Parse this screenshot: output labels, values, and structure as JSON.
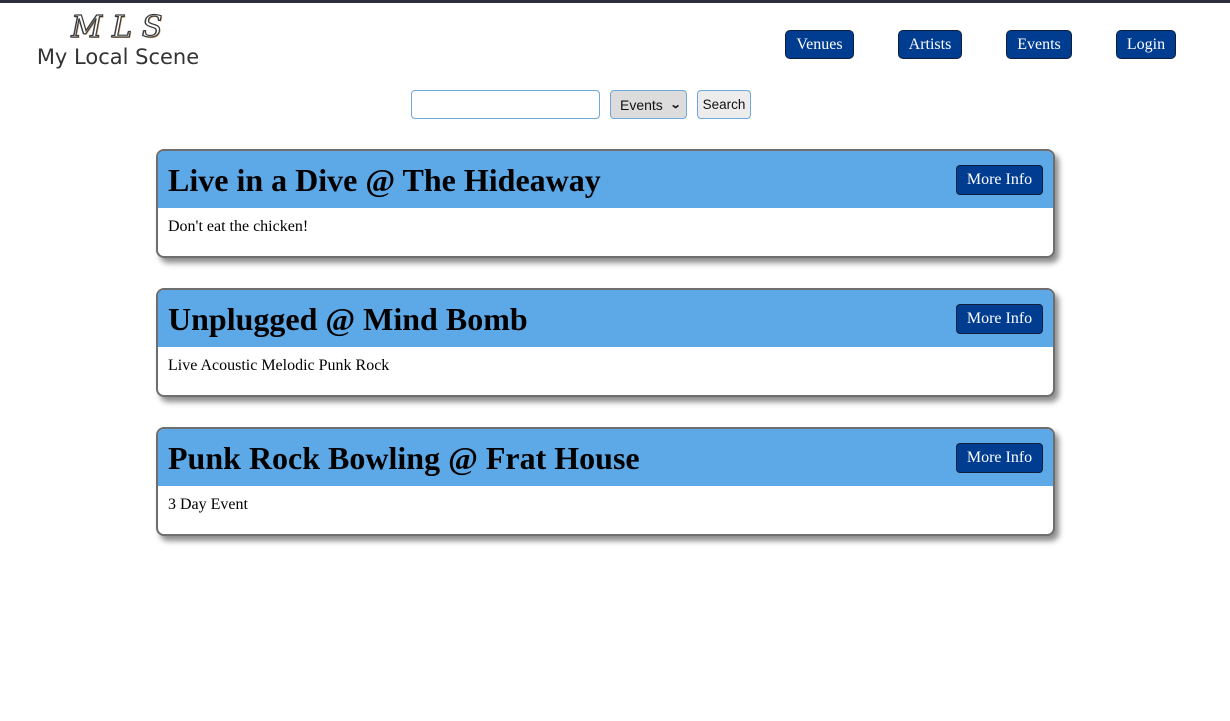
{
  "header": {
    "logo_mark": "MLS",
    "logo_text": "My Local Scene"
  },
  "nav": {
    "items": [
      {
        "label": "Venues"
      },
      {
        "label": "Artists"
      },
      {
        "label": "Events"
      },
      {
        "label": "Login"
      }
    ]
  },
  "search": {
    "value": "",
    "placeholder": "",
    "category_selected": "Events",
    "button_label": "Search"
  },
  "events": [
    {
      "title": "Live in a Dive @ The Hideaway",
      "description": "Don't eat the chicken!",
      "button_label": "More Info"
    },
    {
      "title": "Unplugged @ Mind Bomb",
      "description": "Live Acoustic Melodic Punk Rock",
      "button_label": "More Info"
    },
    {
      "title": "Punk Rock Bowling @ Frat House",
      "description": "3 Day Event",
      "button_label": "More Info"
    }
  ],
  "colors": {
    "nav_button": "#003d91",
    "card_header": "#5da8e6",
    "top_bar": "#2b303b"
  }
}
